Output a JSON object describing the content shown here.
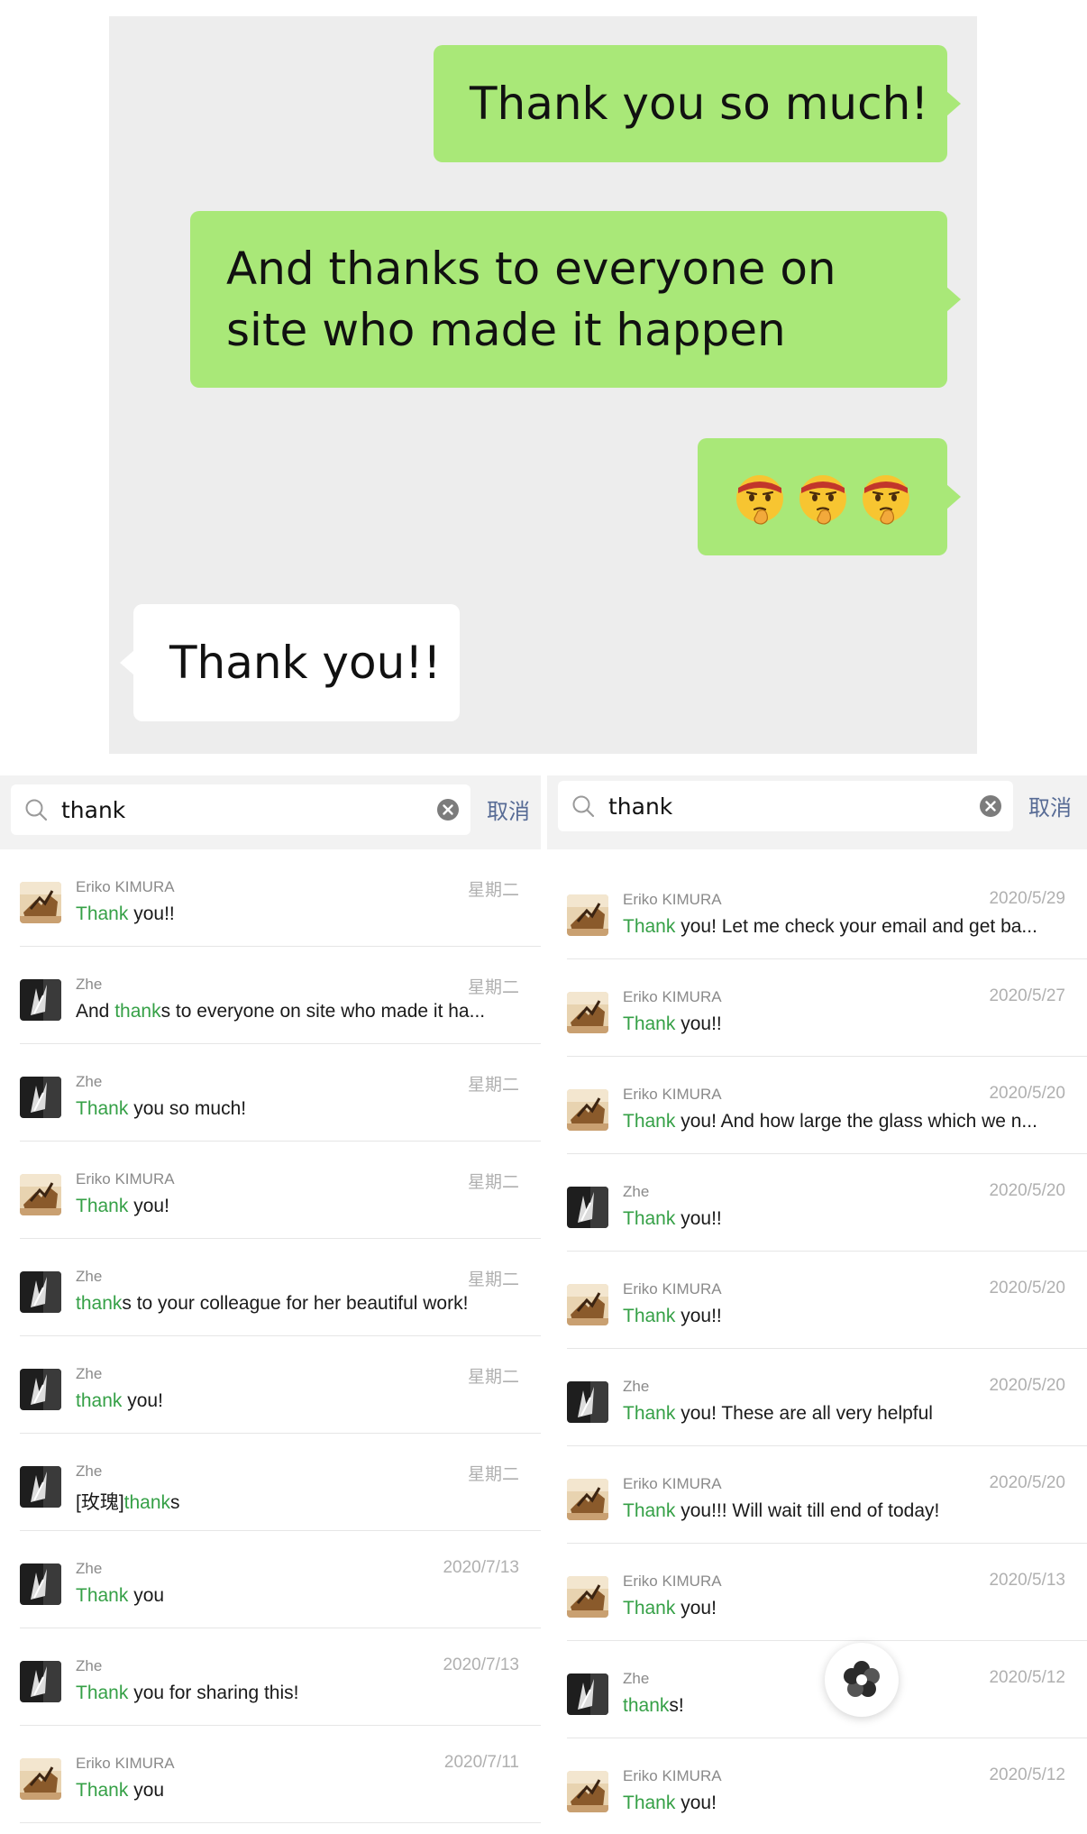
{
  "chat": {
    "messages": [
      {
        "direction": "out",
        "text": "Thank you so much!"
      },
      {
        "direction": "out",
        "text": "And thanks to everyone on site who made it happen"
      },
      {
        "direction": "out",
        "emojis": [
          "thinking-headband-face",
          "thinking-headband-face",
          "thinking-headband-face"
        ]
      },
      {
        "direction": "in",
        "text": "Thank you!!"
      }
    ],
    "colors": {
      "background": "#ededed",
      "outgoing": "#a9e878",
      "incoming": "#ffffff"
    }
  },
  "left_search": {
    "query": "thank",
    "cancel_label": "取消",
    "results": [
      {
        "name": "Eriko KIMURA",
        "date": "星期二",
        "highlight": "Thank",
        "rest": " you!!",
        "avatar": "sculpture-avatar"
      },
      {
        "name": "Zhe",
        "date": "星期二",
        "prefix": "And ",
        "highlight": "thank",
        "rest": "s to everyone on site who made it ha...",
        "avatar": "dark-sculpture-avatar"
      },
      {
        "name": "Zhe",
        "date": "星期二",
        "highlight": "Thank",
        "rest": " you so much!",
        "avatar": "dark-sculpture-avatar"
      },
      {
        "name": "Eriko KIMURA",
        "date": "星期二",
        "highlight": "Thank",
        "rest": " you!",
        "avatar": "sculpture-avatar"
      },
      {
        "name": "Zhe",
        "date": "星期二",
        "highlight": "thank",
        "rest": "s to your colleague for her beautiful work!",
        "avatar": "dark-sculpture-avatar"
      },
      {
        "name": "Zhe",
        "date": "星期二",
        "highlight": "thank",
        "rest": " you!",
        "avatar": "dark-sculpture-avatar"
      },
      {
        "name": "Zhe",
        "date": "星期二",
        "prefix": "[玫瑰]",
        "highlight": "thank",
        "rest": "s",
        "avatar": "dark-sculpture-avatar"
      },
      {
        "name": "Zhe",
        "date": "2020/7/13",
        "highlight": "Thank",
        "rest": " you",
        "avatar": "dark-sculpture-avatar"
      },
      {
        "name": "Zhe",
        "date": "2020/7/13",
        "highlight": "Thank",
        "rest": " you for sharing this!",
        "avatar": "dark-sculpture-avatar"
      },
      {
        "name": "Eriko KIMURA",
        "date": "2020/7/11",
        "highlight": "Thank",
        "rest": " you",
        "avatar": "sculpture-avatar"
      }
    ]
  },
  "right_search": {
    "query": "thank",
    "cancel_label": "取消",
    "results": [
      {
        "name": "Eriko KIMURA",
        "date": "2020/5/29",
        "highlight": "Thank",
        "rest": " you! Let me check your email and get ba...",
        "avatar": "sculpture-avatar"
      },
      {
        "name": "Eriko KIMURA",
        "date": "2020/5/27",
        "highlight": "Thank",
        "rest": " you!!",
        "avatar": "sculpture-avatar"
      },
      {
        "name": "Eriko KIMURA",
        "date": "2020/5/20",
        "highlight": "Thank",
        "rest": " you! And how large the glass which we n...",
        "avatar": "sculpture-avatar"
      },
      {
        "name": "Zhe",
        "date": "2020/5/20",
        "highlight": "Thank",
        "rest": " you!!",
        "avatar": "dark-sculpture-avatar"
      },
      {
        "name": "Eriko KIMURA",
        "date": "2020/5/20",
        "highlight": "Thank",
        "rest": " you!!",
        "avatar": "sculpture-avatar"
      },
      {
        "name": "Zhe",
        "date": "2020/5/20",
        "highlight": "Thank",
        "rest": " you! These are all very helpful",
        "avatar": "dark-sculpture-avatar"
      },
      {
        "name": "Eriko KIMURA",
        "date": "2020/5/20",
        "highlight": "Thank",
        "rest": " you!!! Will wait till end of today!",
        "avatar": "sculpture-avatar"
      },
      {
        "name": "Eriko KIMURA",
        "date": "2020/5/13",
        "highlight": "Thank",
        "rest": " you!",
        "avatar": "sculpture-avatar"
      },
      {
        "name": "Zhe",
        "date": "2020/5/12",
        "highlight": "thank",
        "rest": "s!",
        "avatar": "dark-sculpture-avatar"
      },
      {
        "name": "Eriko KIMURA",
        "date": "2020/5/12",
        "highlight": "Thank",
        "rest": " you!",
        "avatar": "sculpture-avatar"
      }
    ]
  },
  "colors": {
    "highlight": "#35a046",
    "cancel": "#576b95"
  },
  "floating_button": {
    "icon": "spinner-icon"
  }
}
